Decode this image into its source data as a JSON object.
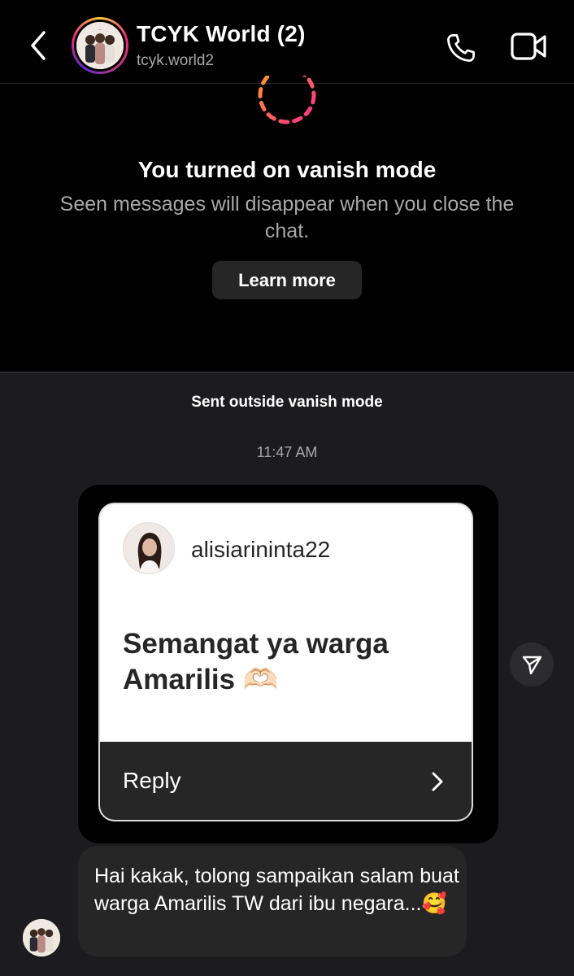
{
  "header": {
    "title": "TCYK World (2)",
    "username": "tcyk.world2"
  },
  "vanish": {
    "title": "You turned on vanish mode",
    "description": "Seen messages will disappear when you close the chat.",
    "learn_more": "Learn more"
  },
  "chat": {
    "sent_outside": "Sent outside vanish mode",
    "time": "11:47 AM",
    "story": {
      "username": "alisiarininta22",
      "text": "Semangat ya warga Amarilis 🫶🏻",
      "reply_label": "Reply"
    },
    "message": {
      "text": "Hai kakak, tolong sampaikan salam buat warga Amarilis TW dari ibu negara...🥰"
    }
  },
  "colors": {
    "background": "#000000",
    "chat_background": "#1c1c1e",
    "bubble": "#262626",
    "secondary_text": "#a8a8a8"
  },
  "icons": {
    "back": "chevron-left-icon",
    "call": "phone-icon",
    "video": "video-camera-icon",
    "share": "paper-plane-icon",
    "reply": "chevron-right-icon"
  }
}
